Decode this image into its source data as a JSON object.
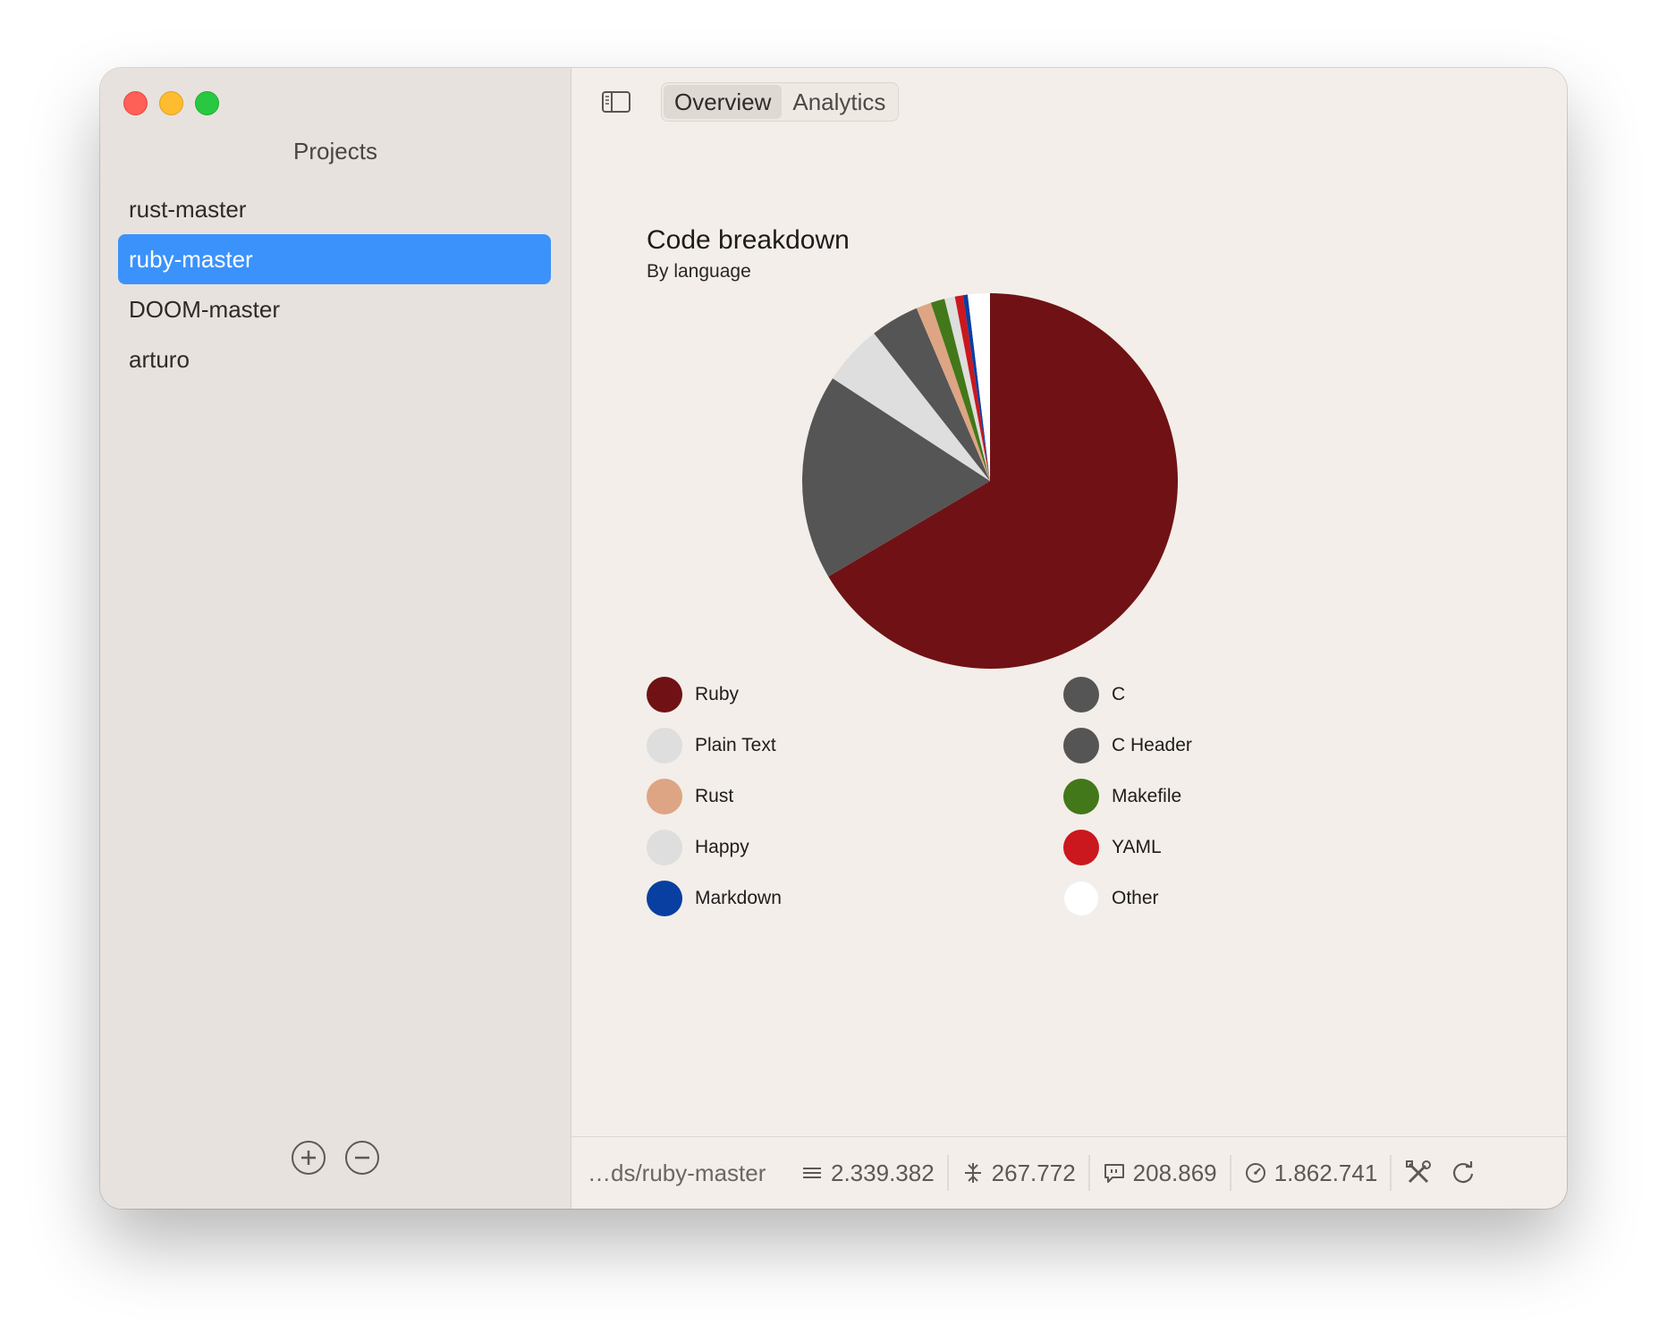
{
  "sidebar": {
    "title": "Projects",
    "items": [
      {
        "label": "rust-master",
        "selected": false
      },
      {
        "label": "ruby-master",
        "selected": true
      },
      {
        "label": "DOOM-master",
        "selected": false
      },
      {
        "label": "arturo",
        "selected": false
      }
    ]
  },
  "tabs": [
    {
      "label": "Overview",
      "active": true
    },
    {
      "label": "Analytics",
      "active": false
    }
  ],
  "chart_data": {
    "type": "pie",
    "title": "Code breakdown",
    "subtitle": "By language",
    "slices": [
      {
        "label": "Ruby",
        "value": 66.5,
        "color": "#701215"
      },
      {
        "label": "C",
        "value": 17.7,
        "color": "#555555"
      },
      {
        "label": "Plain Text",
        "value": 5.2,
        "color": "#dedede"
      },
      {
        "label": "C Header",
        "value": 4.2,
        "color": "#555555"
      },
      {
        "label": "Rust",
        "value": 1.3,
        "color": "#dea584"
      },
      {
        "label": "Makefile",
        "value": 1.2,
        "color": "#427819"
      },
      {
        "label": "Happy",
        "value": 0.9,
        "color": "#dedede"
      },
      {
        "label": "YAML",
        "value": 0.7,
        "color": "#cb171e"
      },
      {
        "label": "Markdown",
        "value": 0.4,
        "color": "#083fa1"
      },
      {
        "label": "Other",
        "value": 1.9,
        "color": "#ffffff"
      }
    ],
    "legend_order": [
      "Ruby",
      "C",
      "Plain Text",
      "C Header",
      "Rust",
      "Makefile",
      "Happy",
      "YAML",
      "Markdown",
      "Other"
    ]
  },
  "statusbar": {
    "path": "…ds/ruby-master",
    "lines": "2.339.382",
    "code": "267.772",
    "comments": "208.869",
    "blanks": "1.862.741"
  },
  "icons": {
    "sidebar_toggle": "sidebar-icon",
    "add": "plus-circle-icon",
    "remove": "minus-circle-icon",
    "lines": "lines-icon",
    "code": "compress-icon",
    "comments": "comment-icon",
    "blanks": "gauge-icon",
    "tools": "tools-icon",
    "refresh": "refresh-icon"
  }
}
